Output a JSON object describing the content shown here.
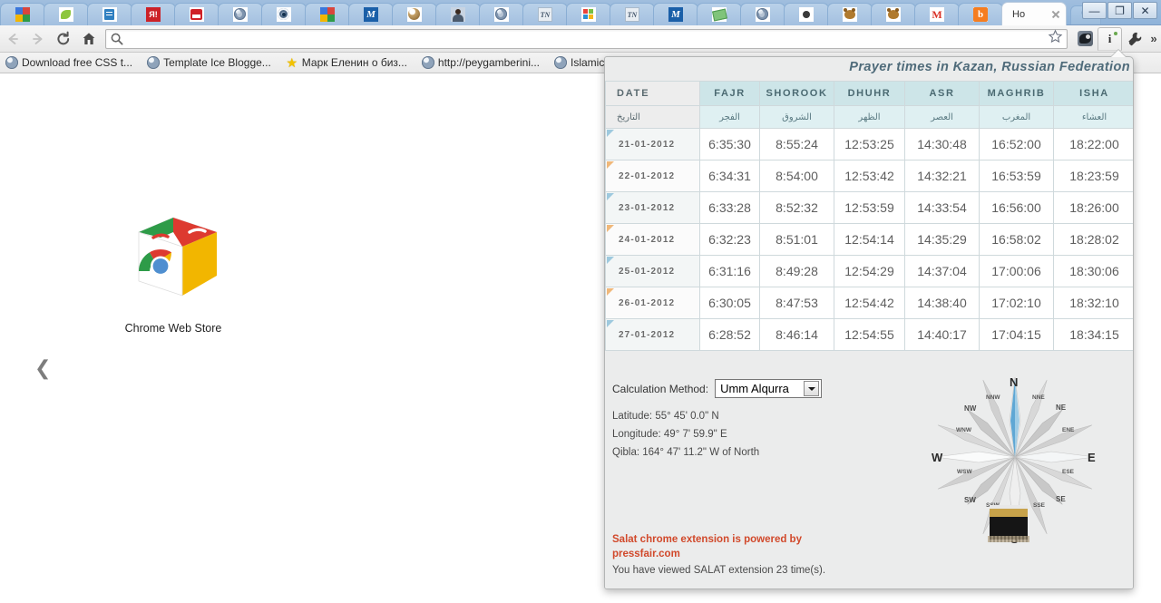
{
  "window": {
    "controls": {
      "minimize": "—",
      "maximize": "❐",
      "close": "✕"
    }
  },
  "tabs": {
    "items": [
      {
        "icon": "google-favicon",
        "icon_class": "fv-google",
        "title": "",
        "active": false
      },
      {
        "icon": "leaf-favicon",
        "icon_class": "fv-leaf",
        "title": "",
        "active": false
      },
      {
        "icon": "document-favicon",
        "icon_class": "fv-doc",
        "title": "",
        "active": false
      },
      {
        "icon": "yandex-favicon",
        "icon_class": "fv-ya",
        "title": "",
        "active": false
      },
      {
        "icon": "salattube-favicon",
        "icon_class": "fv-tube",
        "title": "",
        "active": false
      },
      {
        "icon": "globe-favicon",
        "icon_class": "fv-globe",
        "title": "",
        "active": false
      },
      {
        "icon": "target-favicon",
        "icon_class": "fv-target",
        "title": "",
        "active": false
      },
      {
        "icon": "google-favicon",
        "icon_class": "fv-google",
        "title": "",
        "active": false
      },
      {
        "icon": "m-blue-favicon",
        "icon_class": "fv-m",
        "title": "",
        "active": false
      },
      {
        "icon": "ball-favicon",
        "icon_class": "fv-ball",
        "title": "",
        "active": false
      },
      {
        "icon": "person-favicon",
        "icon_class": "fv-person",
        "title": "",
        "active": false
      },
      {
        "icon": "globe-favicon",
        "icon_class": "fv-globe",
        "title": "",
        "active": false
      },
      {
        "icon": "tn-favicon",
        "icon_class": "fv-tn",
        "title": "",
        "active": false
      },
      {
        "icon": "windows-favicon",
        "icon_class": "fv-win",
        "title": "",
        "active": false
      },
      {
        "icon": "tn-favicon",
        "icon_class": "fv-tn",
        "title": "",
        "active": false
      },
      {
        "icon": "m-blue-favicon",
        "icon_class": "fv-m",
        "title": "",
        "active": false
      },
      {
        "icon": "money-favicon",
        "icon_class": "fv-money",
        "title": "",
        "active": false
      },
      {
        "icon": "globe-favicon",
        "icon_class": "fv-globe",
        "title": "",
        "active": false
      },
      {
        "icon": "dot-favicon",
        "icon_class": "fv-dot",
        "title": "",
        "active": false
      },
      {
        "icon": "bear-favicon",
        "icon_class": "fv-bear",
        "title": "",
        "active": false
      },
      {
        "icon": "bear-favicon",
        "icon_class": "fv-bear",
        "title": "",
        "active": false
      },
      {
        "icon": "gmail-favicon",
        "icon_class": "fv-gmail",
        "title": "",
        "active": false
      },
      {
        "icon": "blogger-favicon",
        "icon_class": "fv-blogger",
        "title": "",
        "active": false
      },
      {
        "icon": "newtab-favicon",
        "icon_class": "fv-none",
        "title": "Ho",
        "active": true
      }
    ],
    "new_tab_label": "+"
  },
  "toolbar": {
    "back_label": "Back",
    "forward_label": "Forward",
    "reload_label": "Reload",
    "home_label": "Home",
    "omnibox_value": "",
    "omnibox_placeholder": "",
    "bookmark_star_label": "Bookmark this page",
    "extension_dark_label": "Extension",
    "extension_info_label": "i",
    "wrench_label": "Customize and control Google Chrome",
    "overflow_label": "»"
  },
  "bookmarks": {
    "items": [
      {
        "icon": "globe-icon",
        "icon_class": "globe",
        "label": "Download free CSS t..."
      },
      {
        "icon": "globe-icon",
        "icon_class": "globe",
        "label": "Template Ice Blogge..."
      },
      {
        "icon": "star-icon",
        "icon_class": "star",
        "label": "Марк Еленин о биз..."
      },
      {
        "icon": "globe-icon",
        "icon_class": "globe",
        "label": "http://peygamberini..."
      },
      {
        "icon": "globe-icon",
        "icon_class": "globe",
        "label": "Islamic"
      }
    ]
  },
  "newtab": {
    "webstore_label": "Chrome Web Store",
    "webstore_icon": "chrome-web-store-icon",
    "prev_arrow": "❮"
  },
  "popup": {
    "title": "Prayer times in Kazan, Russian Federation",
    "table": {
      "headers_en": [
        "DATE",
        "FAJR",
        "SHOROOK",
        "DHUHR",
        "ASR",
        "MAGHRIB",
        "ISHA"
      ],
      "headers_ar": [
        "التاريخ",
        "الفجر",
        "الشروق",
        "الظهر",
        "العصر",
        "المغرب",
        "العشاء"
      ],
      "rows": [
        [
          "21-01-2012",
          "6:35:30",
          "8:55:24",
          "12:53:25",
          "14:30:48",
          "16:52:00",
          "18:22:00"
        ],
        [
          "22-01-2012",
          "6:34:31",
          "8:54:00",
          "12:53:42",
          "14:32:21",
          "16:53:59",
          "18:23:59"
        ],
        [
          "23-01-2012",
          "6:33:28",
          "8:52:32",
          "12:53:59",
          "14:33:54",
          "16:56:00",
          "18:26:00"
        ],
        [
          "24-01-2012",
          "6:32:23",
          "8:51:01",
          "12:54:14",
          "14:35:29",
          "16:58:02",
          "18:28:02"
        ],
        [
          "25-01-2012",
          "6:31:16",
          "8:49:28",
          "12:54:29",
          "14:37:04",
          "17:00:06",
          "18:30:06"
        ],
        [
          "26-01-2012",
          "6:30:05",
          "8:47:53",
          "12:54:42",
          "14:38:40",
          "17:02:10",
          "18:32:10"
        ],
        [
          "27-01-2012",
          "6:28:52",
          "8:46:14",
          "12:54:55",
          "14:40:17",
          "17:04:15",
          "18:34:15"
        ]
      ]
    },
    "calculation_method": {
      "label": "Calculation Method:",
      "value": "Umm Alqurra",
      "options": [
        "Umm Alqurra"
      ]
    },
    "geo": {
      "latitude": "Latitude: 55° 45' 0.0\" N",
      "longitude": "Longitude: 49° 7' 59.9\" E",
      "qibla": "Qibla: 164° 47' 11.2\" W of North"
    },
    "compass": {
      "directions": [
        {
          "label": "N",
          "size": "major"
        },
        {
          "label": "E",
          "size": "major"
        },
        {
          "label": "S",
          "size": "major"
        },
        {
          "label": "W",
          "size": "major"
        },
        {
          "label": "NE",
          "size": "mid"
        },
        {
          "label": "SE",
          "size": "mid"
        },
        {
          "label": "SW",
          "size": "mid"
        },
        {
          "label": "NW",
          "size": "mid"
        },
        {
          "label": "NNE",
          "size": "minor"
        },
        {
          "label": "ENE",
          "size": "minor"
        },
        {
          "label": "ESE",
          "size": "minor"
        },
        {
          "label": "SSE",
          "size": "minor"
        },
        {
          "label": "SSW",
          "size": "minor"
        },
        {
          "label": "WSW",
          "size": "minor"
        },
        {
          "label": "WNW",
          "size": "minor"
        },
        {
          "label": "NNW",
          "size": "minor"
        }
      ],
      "needle_color": "#5fa7d4",
      "kaaba_icon": "kaaba-icon"
    },
    "footer": {
      "powered_line1": "Salat chrome extension is powered by",
      "powered_line2": "pressfair.com",
      "views": "You have viewed SALAT extension 23 time(s)."
    },
    "colors": {
      "title": "#4f6b7a",
      "header_bg": "#cde5e8",
      "accent_red": "#d1492b",
      "panel_bg": "#ebecec"
    }
  }
}
